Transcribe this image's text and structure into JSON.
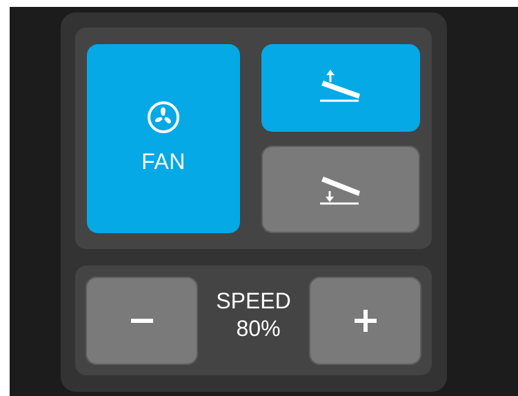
{
  "fan_button": {
    "label": "FAN",
    "icon": "fan-icon",
    "state": "active"
  },
  "tilt_up_button": {
    "icon": "recline-up-icon",
    "state": "active"
  },
  "tilt_down_button": {
    "icon": "recline-down-icon",
    "state": "inactive"
  },
  "speed": {
    "label": "SPEED",
    "value": "80%"
  },
  "decrease_button": {
    "label": "−"
  },
  "increase_button": {
    "label": "+"
  },
  "colors": {
    "accent": "#04a9e6",
    "inactive": "#7a7a7a",
    "panel": "#333333",
    "group": "#444444",
    "background": "#1c1c1c"
  }
}
